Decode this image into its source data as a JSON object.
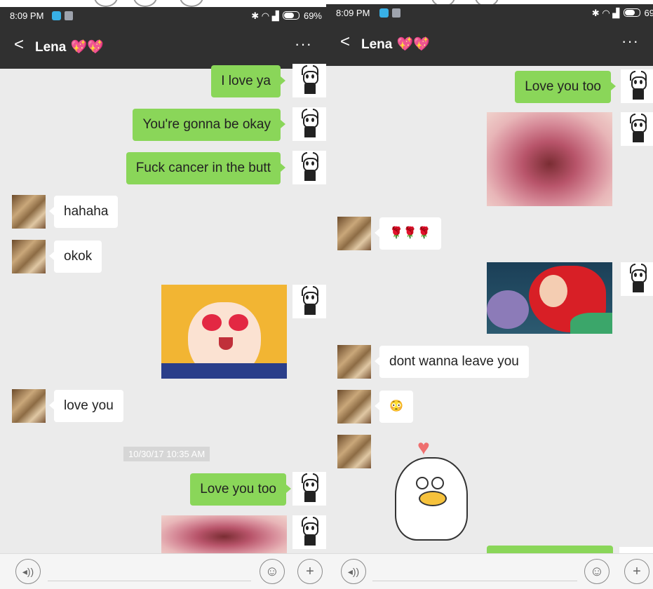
{
  "status": {
    "time": "8:09 PM",
    "battery_left": "69%",
    "battery_right": "69"
  },
  "chat": {
    "contact_name": "Lena",
    "hearts": "💖💖",
    "more": "···",
    "back": "<"
  },
  "left_messages": [
    {
      "from": "me",
      "text": "I love ya"
    },
    {
      "from": "me",
      "text": "You're gonna be okay"
    },
    {
      "from": "me",
      "text": "Fuck cancer in the butt"
    },
    {
      "from": "them",
      "text": "hahaha"
    },
    {
      "from": "them",
      "text": "okok"
    },
    {
      "from": "them",
      "text": "love you"
    },
    {
      "from": "me",
      "text": "Love you too"
    }
  ],
  "left_timestamp": "10/30/17 10:35 AM",
  "right_messages": [
    {
      "from": "me",
      "text": "Love you too"
    },
    {
      "from": "them",
      "text": "🌹🌹🌹"
    },
    {
      "from": "them",
      "text": "dont wanna leave you"
    },
    {
      "from": "them",
      "text": "😳"
    }
  ],
  "icons": {
    "back": "chevron-left-icon",
    "more": "more-dots-icon",
    "voice": "voice-icon",
    "emoji": "emoji-icon",
    "add": "plus-icon"
  },
  "colors": {
    "header": "#303030",
    "sent_bubble": "#8ad659",
    "received_bubble": "#ffffff",
    "background": "#ebebeb"
  }
}
